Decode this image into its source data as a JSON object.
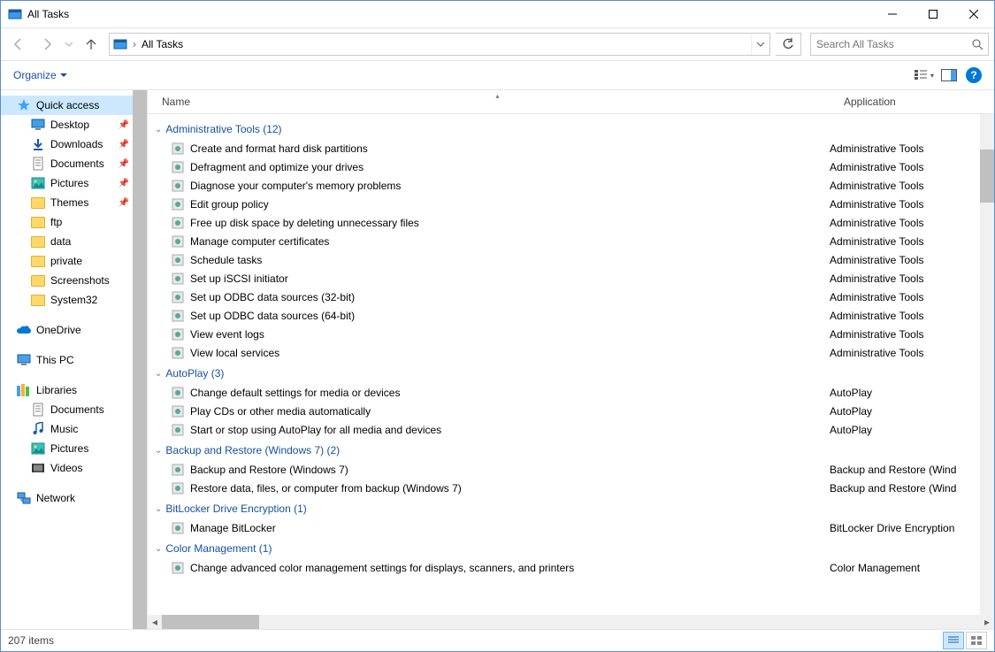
{
  "window": {
    "title": "All Tasks"
  },
  "address": {
    "crumb": "All Tasks"
  },
  "search": {
    "placeholder": "Search All Tasks"
  },
  "toolbar": {
    "organize": "Organize"
  },
  "columns": {
    "name": "Name",
    "app": "Application"
  },
  "sidebar": {
    "quick": "Quick access",
    "items": [
      {
        "label": "Desktop",
        "pin": true,
        "icon": "desktop"
      },
      {
        "label": "Downloads",
        "pin": true,
        "icon": "downloads"
      },
      {
        "label": "Documents",
        "pin": true,
        "icon": "documents"
      },
      {
        "label": "Pictures",
        "pin": true,
        "icon": "pictures"
      },
      {
        "label": "Themes",
        "pin": true,
        "icon": "folder"
      },
      {
        "label": "ftp",
        "pin": false,
        "icon": "folder"
      },
      {
        "label": "data",
        "pin": false,
        "icon": "folder"
      },
      {
        "label": "private",
        "pin": false,
        "icon": "folder"
      },
      {
        "label": "Screenshots",
        "pin": false,
        "icon": "folder"
      },
      {
        "label": "System32",
        "pin": false,
        "icon": "folder"
      }
    ],
    "onedrive": "OneDrive",
    "thispc": "This PC",
    "libraries": "Libraries",
    "libs": [
      {
        "label": "Documents",
        "icon": "documents"
      },
      {
        "label": "Music",
        "icon": "music"
      },
      {
        "label": "Pictures",
        "icon": "pictures"
      },
      {
        "label": "Videos",
        "icon": "videos"
      }
    ],
    "network": "Network"
  },
  "groups": [
    {
      "title": "Administrative Tools (12)",
      "app": "Administrative Tools",
      "items": [
        "Create and format hard disk partitions",
        "Defragment and optimize your drives",
        "Diagnose your computer's memory problems",
        "Edit group policy",
        "Free up disk space by deleting unnecessary files",
        "Manage computer certificates",
        "Schedule tasks",
        "Set up iSCSI initiator",
        "Set up ODBC data sources (32-bit)",
        "Set up ODBC data sources (64-bit)",
        "View event logs",
        "View local services"
      ]
    },
    {
      "title": "AutoPlay (3)",
      "app": "AutoPlay",
      "items": [
        "Change default settings for media or devices",
        "Play CDs or other media automatically",
        "Start or stop using AutoPlay for all media and devices"
      ]
    },
    {
      "title": "Backup and Restore (Windows 7) (2)",
      "app": "Backup and Restore (Wind",
      "items": [
        "Backup and Restore (Windows 7)",
        "Restore data, files, or computer from backup (Windows 7)"
      ]
    },
    {
      "title": "BitLocker Drive Encryption (1)",
      "app": "BitLocker Drive Encryption",
      "items": [
        "Manage BitLocker"
      ]
    },
    {
      "title": "Color Management (1)",
      "app": "Color Management",
      "items": [
        "Change advanced color management settings for displays, scanners, and printers"
      ]
    }
  ],
  "status": {
    "count": "207 items"
  }
}
